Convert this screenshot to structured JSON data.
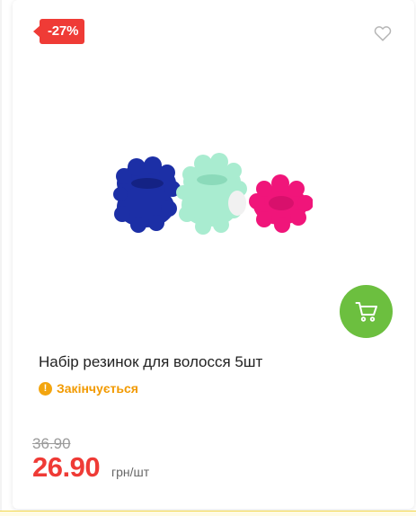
{
  "product": {
    "discount": "-27%",
    "title": "Набір резинок для волосся 5шт",
    "stock_status": "Закінчується",
    "stock_icon": "!",
    "old_price": "36.90",
    "price": "26.90",
    "price_unit": "грн/шт"
  },
  "icons": {
    "favorite": "heart-outline-icon",
    "cart": "cart-icon",
    "stock": "exclamation-icon"
  },
  "colors": {
    "accent_red": "#ef3b36",
    "cart_green": "#6cbf3f",
    "warning_orange": "#f29a00"
  }
}
